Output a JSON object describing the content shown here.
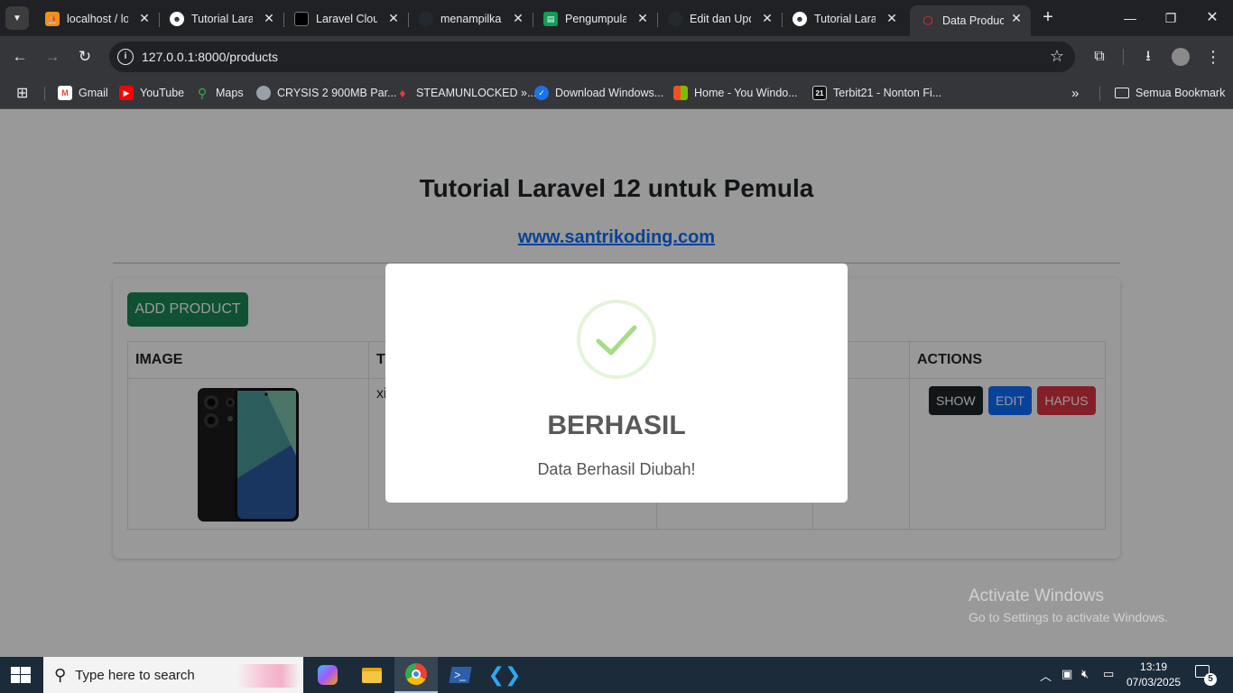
{
  "browser": {
    "tabs": [
      {
        "title": "localhost / lo",
        "icon": "phpmyadmin-icon"
      },
      {
        "title": "Tutorial Lara",
        "icon": "santrikoding-icon"
      },
      {
        "title": "Laravel Cloud",
        "icon": "laravel-cloud-icon"
      },
      {
        "title": "menampilkan",
        "icon": "github-icon"
      },
      {
        "title": "Pengumpulan",
        "icon": "google-sheets-icon"
      },
      {
        "title": "Edit dan Upd",
        "icon": "github-icon"
      },
      {
        "title": "Tutorial Lara",
        "icon": "santrikoding-icon"
      },
      {
        "title": "Data Product",
        "icon": "laravel-icon",
        "active": true
      }
    ],
    "url": "127.0.0.1:8000/products",
    "bookmarks": [
      {
        "label": "Gmail"
      },
      {
        "label": "YouTube"
      },
      {
        "label": "Maps"
      },
      {
        "label": "CRYSIS 2 900MB Par..."
      },
      {
        "label": "STEAMUNLOCKED »..."
      },
      {
        "label": "Download Windows..."
      },
      {
        "label": "Home - You Windo..."
      },
      {
        "label": "Terbit21 - Nonton Fi..."
      }
    ],
    "all_bookmarks": "Semua Bookmark"
  },
  "page": {
    "title": "Tutorial Laravel 12 untuk Pemula",
    "link": "www.santrikoding.com",
    "add_button": "ADD PRODUCT",
    "table": {
      "headers": [
        "IMAGE",
        "T",
        "",
        "CK",
        "ACTIONS"
      ],
      "rows": [
        {
          "title": "xi",
          "actions": [
            "SHOW",
            "EDIT",
            "HAPUS"
          ]
        }
      ]
    }
  },
  "modal": {
    "title": "BERHASIL",
    "message": "Data Berhasil Diubah!",
    "success_color": "#a5dc86"
  },
  "watermark": {
    "line1": "Activate Windows",
    "line2": "Go to Settings to activate Windows."
  },
  "taskbar": {
    "search_placeholder": "Type here to search",
    "time": "13:19",
    "date": "07/03/2025",
    "notification_count": "5"
  }
}
